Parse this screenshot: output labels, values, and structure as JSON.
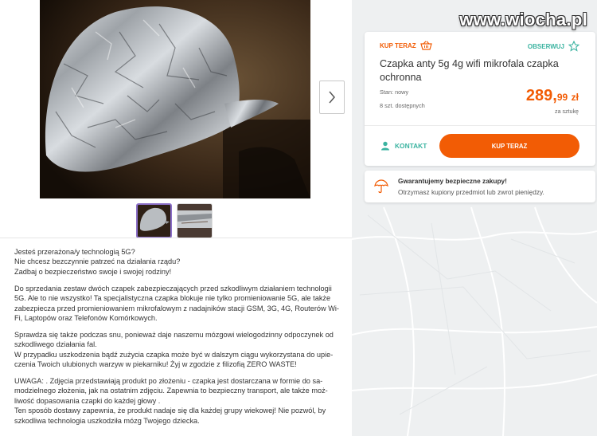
{
  "watermark": "www.wiocha.pl",
  "offer": {
    "buy_now_tag": "KUP TERAZ",
    "watch_label": "OBSERWUJ",
    "title": "Czapka anty 5g 4g wifi mikrofala czapka ochronna",
    "condition": "Stan: nowy",
    "available": "8 szt. dostępnych",
    "price_int": "289,",
    "price_dec": "99",
    "currency": "zł",
    "per_item": "za sztukę",
    "contact_label": "KONTAKT",
    "buy_button_label": "KUP TERAZ"
  },
  "guarantee": {
    "title": "Gwarantujemy bezpieczne zakupy!",
    "subtitle": "Otrzymasz kupiony przedmiot lub zwrot pieniędzy."
  },
  "gallery": {
    "thumbnail_count": 2,
    "active_thumbnail": 1
  },
  "description": [
    "Jesteś przerażona/y technologią 5G?\nNie chcesz bezczynnie patrzeć na działania rządu?\nZadbaj o bezpieczeństwo swoje i swojej rodziny!",
    "Do sprzedania zestaw dwóch czapek zabezpieczających przed szkodliwym działaniem technologii 5G. Ale to nie wszystko! Ta specjalistyczna czapka blokuje nie tylko promieniowanie 5G, ale także zabezpiecza przed promieniowaniem mikrofalowym z nadajników stacji GSM, 3G, 4G, Routerów Wi-Fi, Laptopów oraz Telefonów Komórkowych.",
    "Sprawdza się także podczas snu, ponieważ daje naszemu mózgowi wielogodzinny odpoczynek od szkodliwego działania fal.\nW przypadku uszkodzenia bądź zużycia czapka może być w dalszym ciągu wykorzystana do upie-\nczenia Twoich ulubionych warzyw w piekarniku! Żyj w zgodzie z filizofią ZERO WASTE!",
    "UWAGA: . Zdjęcia przedstawiają produkt po złożeniu - czapka jest dostarczana w formie do sa-\nmodzielnego złożenia, jak na ostatnim zdjęciu. Zapewnia to bezpieczny transport, ale także moż-\nliwość dopasowania czapki do każdej głowy .\nTen sposób dostawy zapewnia, że produkt nadaje się dla każdej grupy wiekowej! Nie pozwól, by szkodliwa technologia uszkodziła mózg Twojego dziecka."
  ],
  "colors": {
    "accent_orange": "#f25c05",
    "accent_teal": "#3ab3a0",
    "thumb_active_border": "#8b6fc7"
  }
}
